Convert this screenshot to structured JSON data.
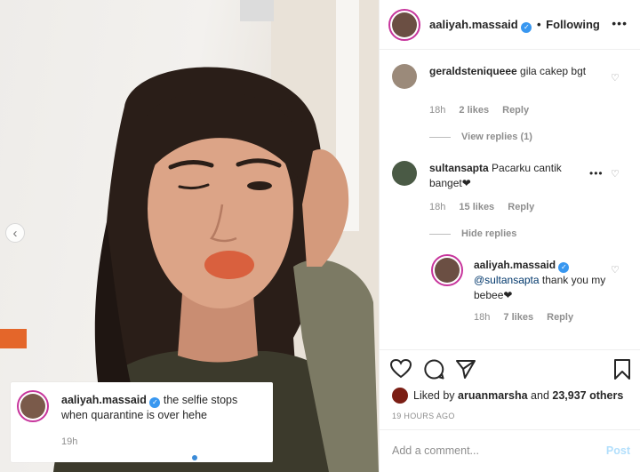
{
  "post": {
    "image_alt": "selfie",
    "prev_label": "‹",
    "caption": {
      "username": "aaliyah.massaid",
      "verified_glyph": "✓",
      "text": "the selfie stops when quarantine is over hehe",
      "time": "19h"
    },
    "carousel": {
      "count": 3,
      "active_index": 2
    }
  },
  "header": {
    "username": "aaliyah.massaid",
    "verified_glyph": "✓",
    "separator": "•",
    "follow_label": "Following",
    "more_label": "•••"
  },
  "comments": [
    {
      "username": "geraldsteniqueee",
      "text": "gila cakep bgt",
      "time": "18h",
      "likes": "2 likes",
      "reply_label": "Reply",
      "view_replies": "View replies (1)"
    },
    {
      "username": "sultansapta",
      "text": "Pacarku cantik banget❤",
      "time": "18h",
      "likes": "15 likes",
      "reply_label": "Reply",
      "more_label": "•••",
      "hide_replies": "Hide replies",
      "reply": {
        "username": "aaliyah.massaid",
        "verified_glyph": "✓",
        "mention": "@sultansapta",
        "text": "thank you my bebee❤",
        "time": "18h",
        "likes": "7 likes",
        "reply_label": "Reply"
      }
    }
  ],
  "actions": {
    "icons": [
      "heart-icon",
      "comment-icon",
      "share-icon",
      "bookmark-icon"
    ],
    "liked_by_prefix": "Liked by",
    "liked_by_user": "aruanmarsha",
    "liked_by_and": "and",
    "liked_by_others": "23,937 others",
    "posted_ago": "19 HOURS AGO"
  },
  "add_comment": {
    "placeholder": "Add a comment...",
    "post_label": "Post"
  },
  "colors": {
    "link_blue": "#00376b",
    "verified_blue": "#3897f0",
    "post_button_disabled": "#b2dffc",
    "story_ring": "#c7359c",
    "muted_text": "#8e8e8e"
  }
}
